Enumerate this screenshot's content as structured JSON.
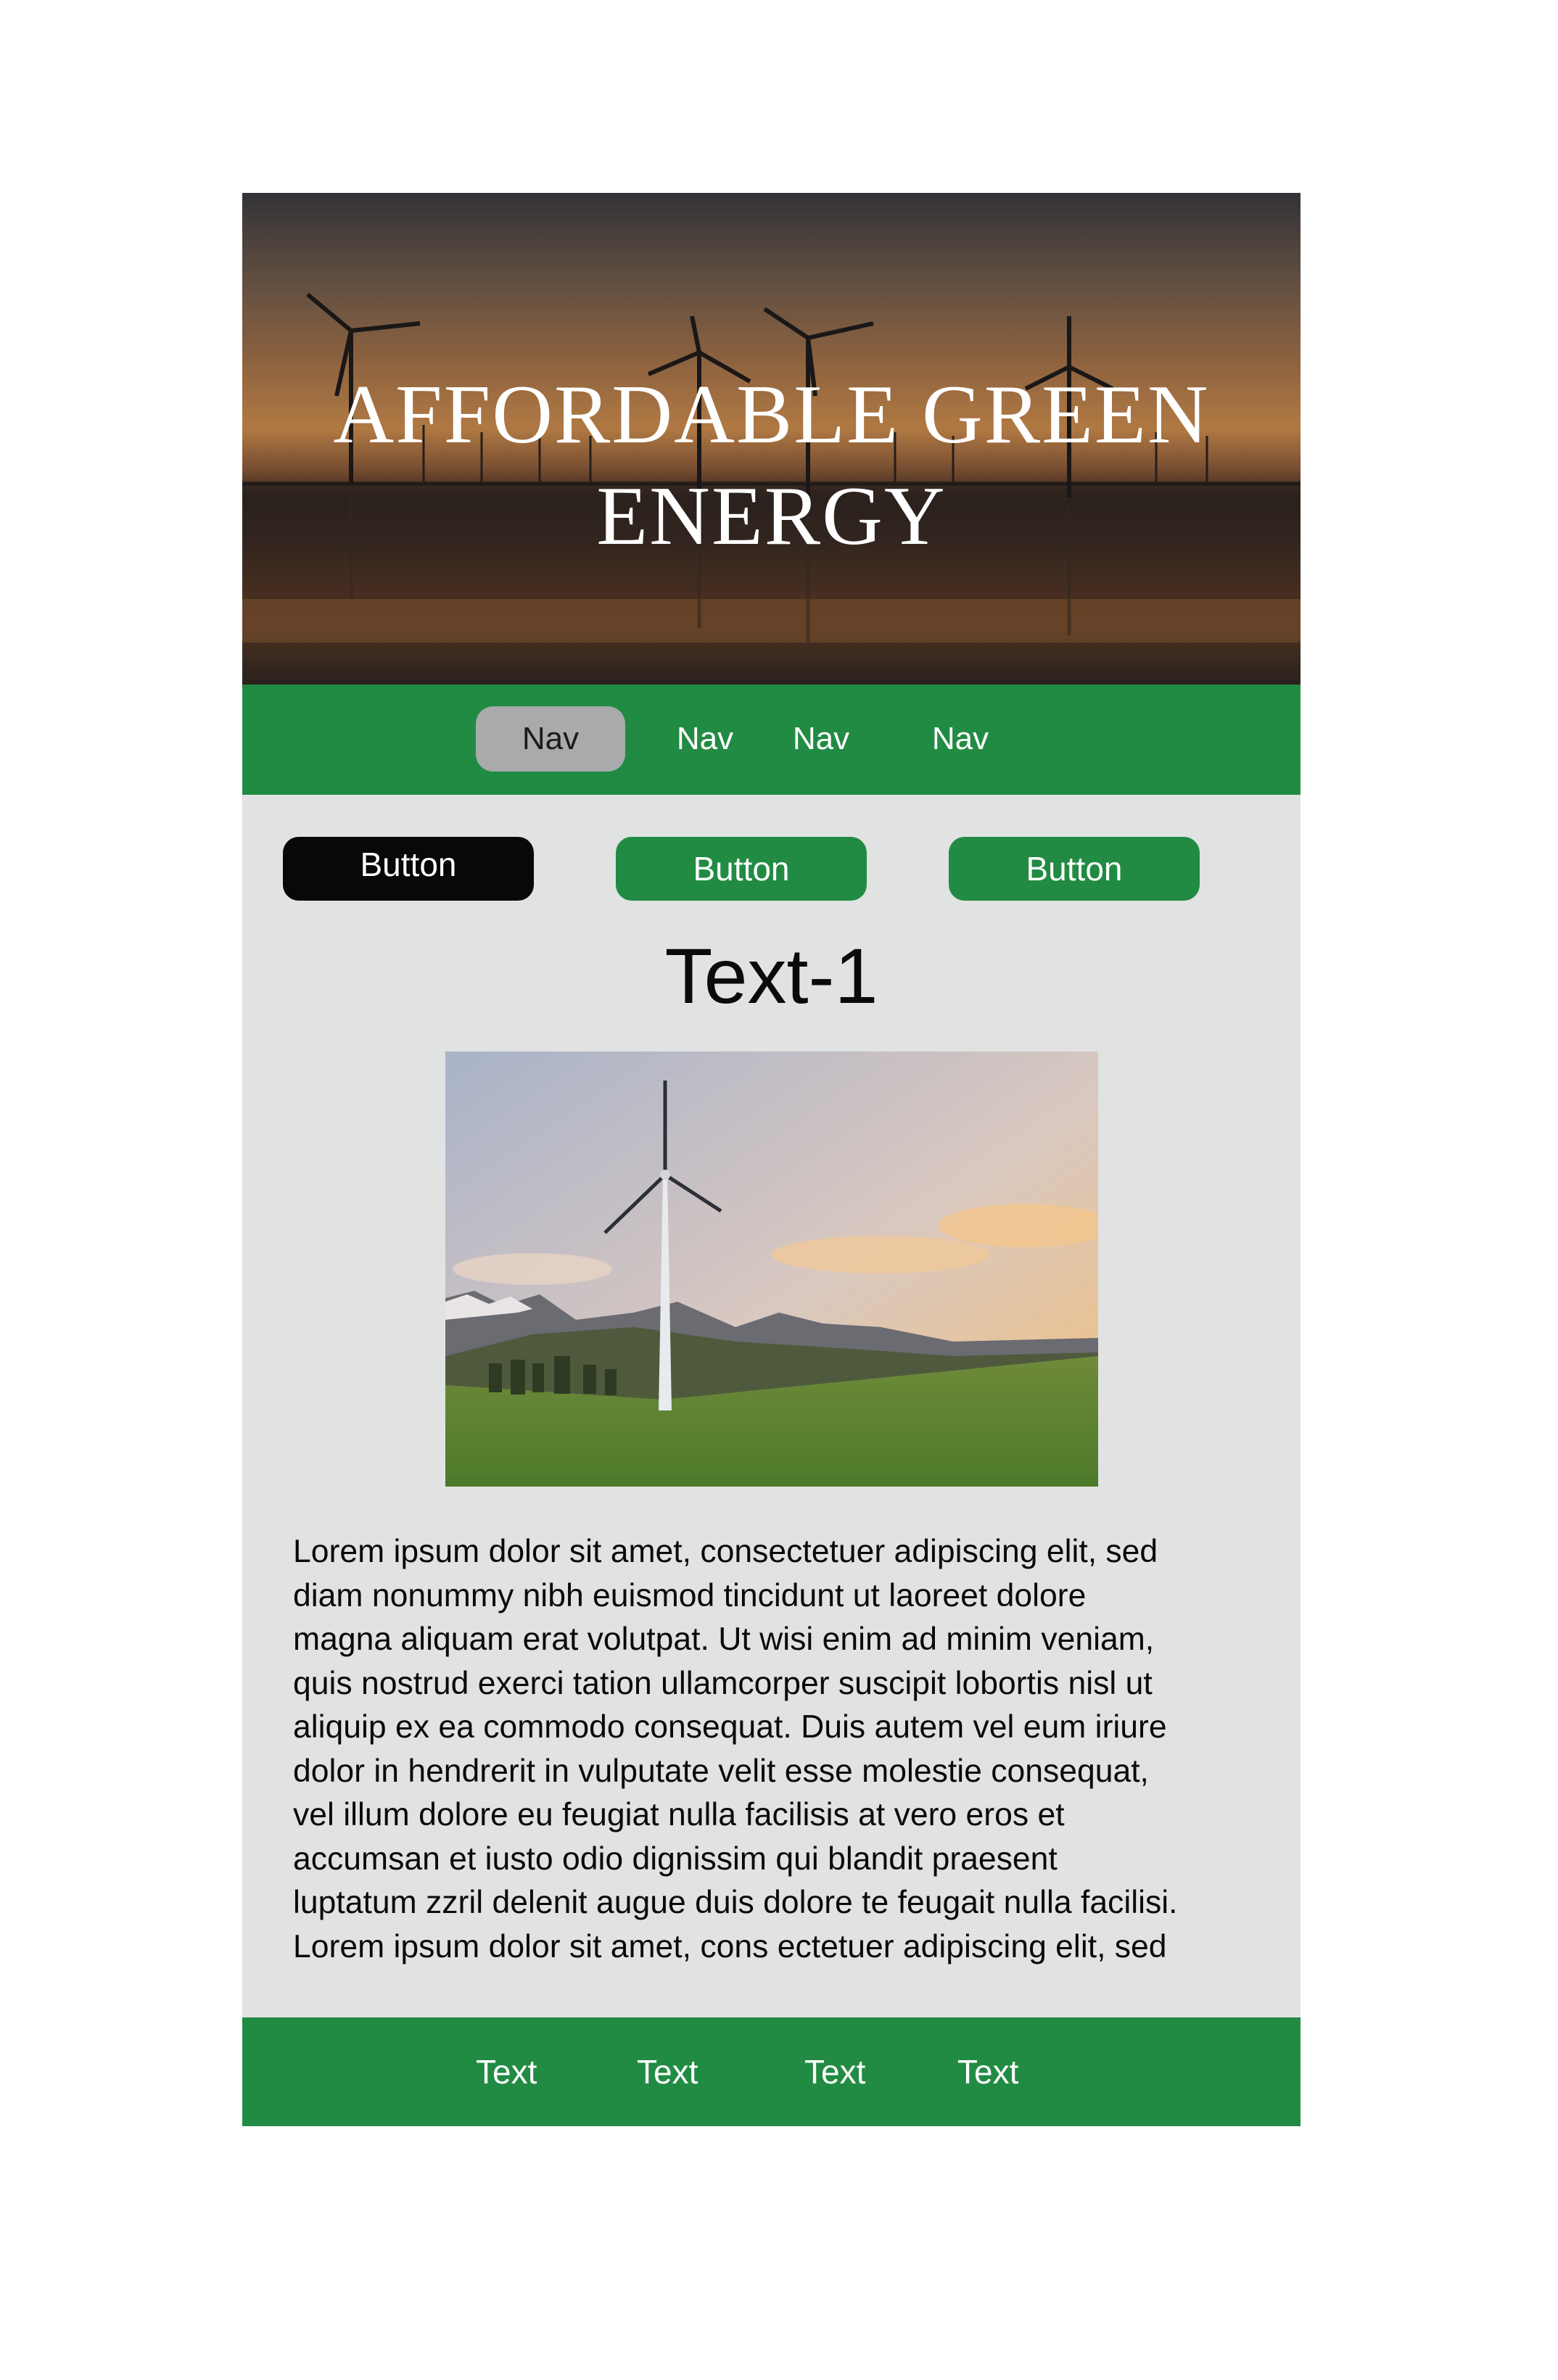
{
  "hero": {
    "title_line1": "AFFORDABLE GREEN",
    "title_line2": "ENERGY",
    "image": "wind-turbines-sunset-photo"
  },
  "nav": {
    "items": [
      {
        "label": "Nav",
        "active": true
      },
      {
        "label": "Nav",
        "active": false
      },
      {
        "label": "Nav",
        "active": false
      },
      {
        "label": "Nav",
        "active": false
      }
    ]
  },
  "buttons": [
    {
      "label": "Button",
      "color": "#060809"
    },
    {
      "label": "Button",
      "color": "#228b43"
    },
    {
      "label": "Button",
      "color": "#228b43"
    }
  ],
  "main": {
    "heading": "Text-1",
    "image": "wind-turbine-landscape-photo",
    "paragraph_lines": [
      "Lorem ipsum dolor sit amet, consectetuer adipiscing elit, sed",
      "diam nonummy nibh euismod tincidunt ut laoreet dolore",
      "magna aliquam erat volutpat. Ut wisi enim ad minim veniam,",
      "quis nostrud exerci tation ullamcorper suscipit lobortis nisl ut",
      "aliquip ex ea commodo consequat. Duis autem vel eum iriure",
      "dolor in hendrerit in vulputate velit esse molestie consequat,",
      "vel illum dolore eu feugiat nulla facilisis at vero eros et",
      "accumsan et iusto odio dignissim qui blandit praesent",
      "luptatum zzril delenit augue duis dolore te feugait nulla facilisi.",
      "Lorem ipsum dolor sit amet, cons ectetuer adipiscing elit, sed"
    ]
  },
  "footer": {
    "items": [
      "Text",
      "Text",
      "Text",
      "Text"
    ]
  },
  "colors": {
    "accent_green": "#228b43",
    "content_background": "#e1e2e2",
    "active_nav": "#a8aaab"
  }
}
